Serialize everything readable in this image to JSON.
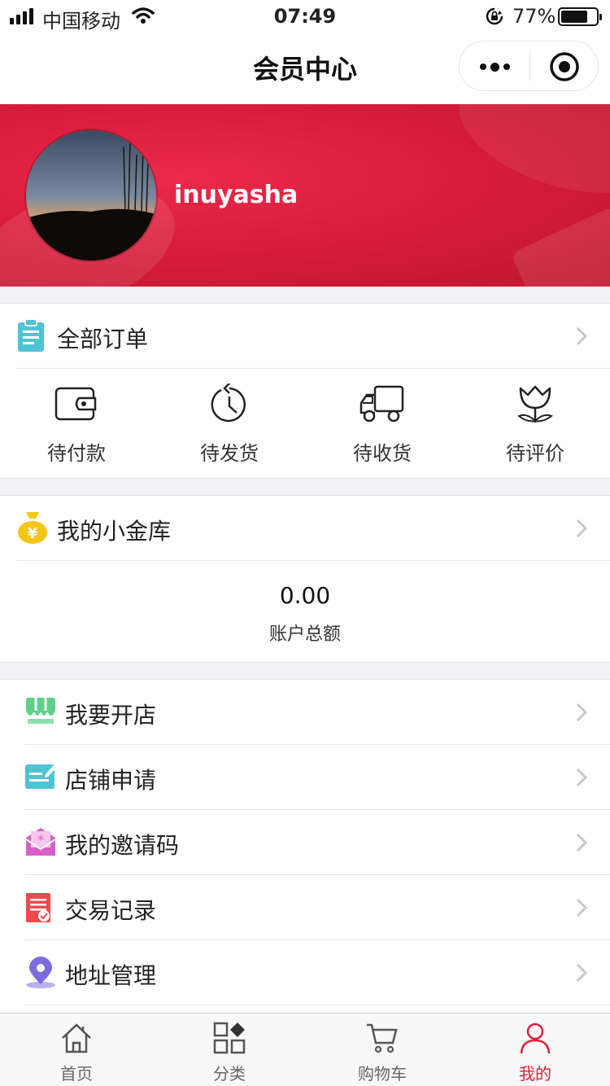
{
  "status_bar": {
    "carrier": "中国移动",
    "time": "07:49",
    "battery_percent": "77%",
    "battery_level": 0.77
  },
  "nav": {
    "title": "会员中心"
  },
  "profile": {
    "username": "inuyasha"
  },
  "orders": {
    "title": "全部订单",
    "items": [
      {
        "label": "待付款",
        "icon": "wallet-icon"
      },
      {
        "label": "待发货",
        "icon": "clock-icon"
      },
      {
        "label": "待收货",
        "icon": "truck-icon"
      },
      {
        "label": "待评价",
        "icon": "tulip-icon"
      }
    ]
  },
  "vault": {
    "title": "我的小金库",
    "balance": "0.00",
    "balance_label": "账户总额"
  },
  "menu": [
    {
      "label": "我要开店",
      "icon": "shop-icon",
      "color": "#5fd08a"
    },
    {
      "label": "店铺申请",
      "icon": "apply-icon",
      "color": "#4fc4d4"
    },
    {
      "label": "我的邀请码",
      "icon": "invite-icon",
      "color": "#d95fc6"
    },
    {
      "label": "交易记录",
      "icon": "record-icon",
      "color": "#f0484e"
    },
    {
      "label": "地址管理",
      "icon": "location-icon",
      "color": "#7b6cde"
    }
  ],
  "tabs": [
    {
      "label": "首页",
      "icon": "home-icon"
    },
    {
      "label": "分类",
      "icon": "category-icon"
    },
    {
      "label": "购物车",
      "icon": "cart-icon"
    },
    {
      "label": "我的",
      "icon": "user-icon"
    }
  ],
  "colors": {
    "accent": "#e0203c",
    "banner": "#d91c3c"
  }
}
